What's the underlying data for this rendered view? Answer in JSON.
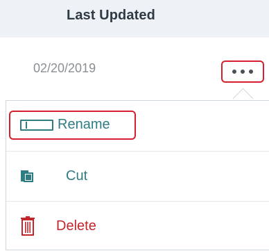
{
  "table": {
    "header": "Last Updated",
    "date": "02/20/2019"
  },
  "menu": {
    "rename": "Rename",
    "cut": "Cut",
    "delete": "Delete"
  },
  "colors": {
    "accent_teal": "#2e7d83",
    "delete_red": "#c1272d",
    "highlight_red": "#d61f2c",
    "header_bg": "#eef1f5"
  },
  "icons": {
    "more": "more-horizontal-icon",
    "rename": "rename-icon",
    "cut": "cut-icon",
    "delete": "trash-icon"
  }
}
